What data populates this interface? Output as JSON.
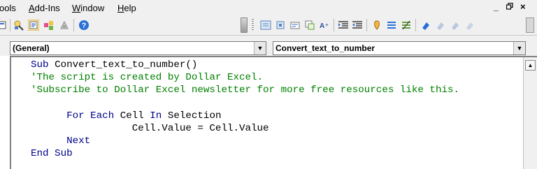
{
  "menu": {
    "items": [
      {
        "pre": "ools",
        "u": "",
        "post": ""
      },
      {
        "pre": "",
        "u": "A",
        "post": "dd-Ins"
      },
      {
        "pre": "",
        "u": "W",
        "post": "indow"
      },
      {
        "pre": "",
        "u": "H",
        "post": "elp"
      }
    ],
    "minimize": "_",
    "restore": "ᵖ",
    "close": "×"
  },
  "toolbar": {
    "icons": [
      "userform-icon",
      "project-explorer-icon",
      "properties-icon",
      "object-browser-icon",
      "toolbox-icon",
      "help-icon",
      "list-properties-icon",
      "list-constants-icon",
      "quick-info-icon",
      "parameter-info-icon",
      "complete-word-icon",
      "indent-icon",
      "outdent-icon",
      "toggle-breakpoint-icon",
      "comment-block-icon",
      "uncomment-block-icon",
      "toggle-bookmark-icon",
      "next-bookmark-icon",
      "previous-bookmark-icon",
      "clear-bookmarks-icon"
    ]
  },
  "procbar": {
    "object": "(General)",
    "procedure": "Convert_text_to_number",
    "dropdown_glyph": "▼"
  },
  "code": {
    "lines": [
      [
        {
          "t": "Sub ",
          "c": "kw"
        },
        {
          "t": "Convert_text_to_number()",
          "c": "plain"
        }
      ],
      [
        {
          "t": "'The script is created by Dollar Excel.",
          "c": "cmt"
        }
      ],
      [
        {
          "t": "'Subscribe to Dollar Excel newsletter for more free resources like this.",
          "c": "cmt"
        }
      ],
      [
        {
          "t": "",
          "c": "plain"
        }
      ],
      [
        {
          "t": "      ",
          "c": "plain"
        },
        {
          "t": "For Each ",
          "c": "kw"
        },
        {
          "t": "Cell ",
          "c": "plain"
        },
        {
          "t": "In ",
          "c": "kw"
        },
        {
          "t": "Selection",
          "c": "plain"
        }
      ],
      [
        {
          "t": "                 Cell.Value = Cell.Value",
          "c": "plain"
        }
      ],
      [
        {
          "t": "      ",
          "c": "plain"
        },
        {
          "t": "Next",
          "c": "kw"
        }
      ],
      [
        {
          "t": "End Sub",
          "c": "kw"
        }
      ]
    ]
  },
  "colors": {
    "keyword": "#00008b",
    "comment": "#008000",
    "plain": "#000000"
  }
}
